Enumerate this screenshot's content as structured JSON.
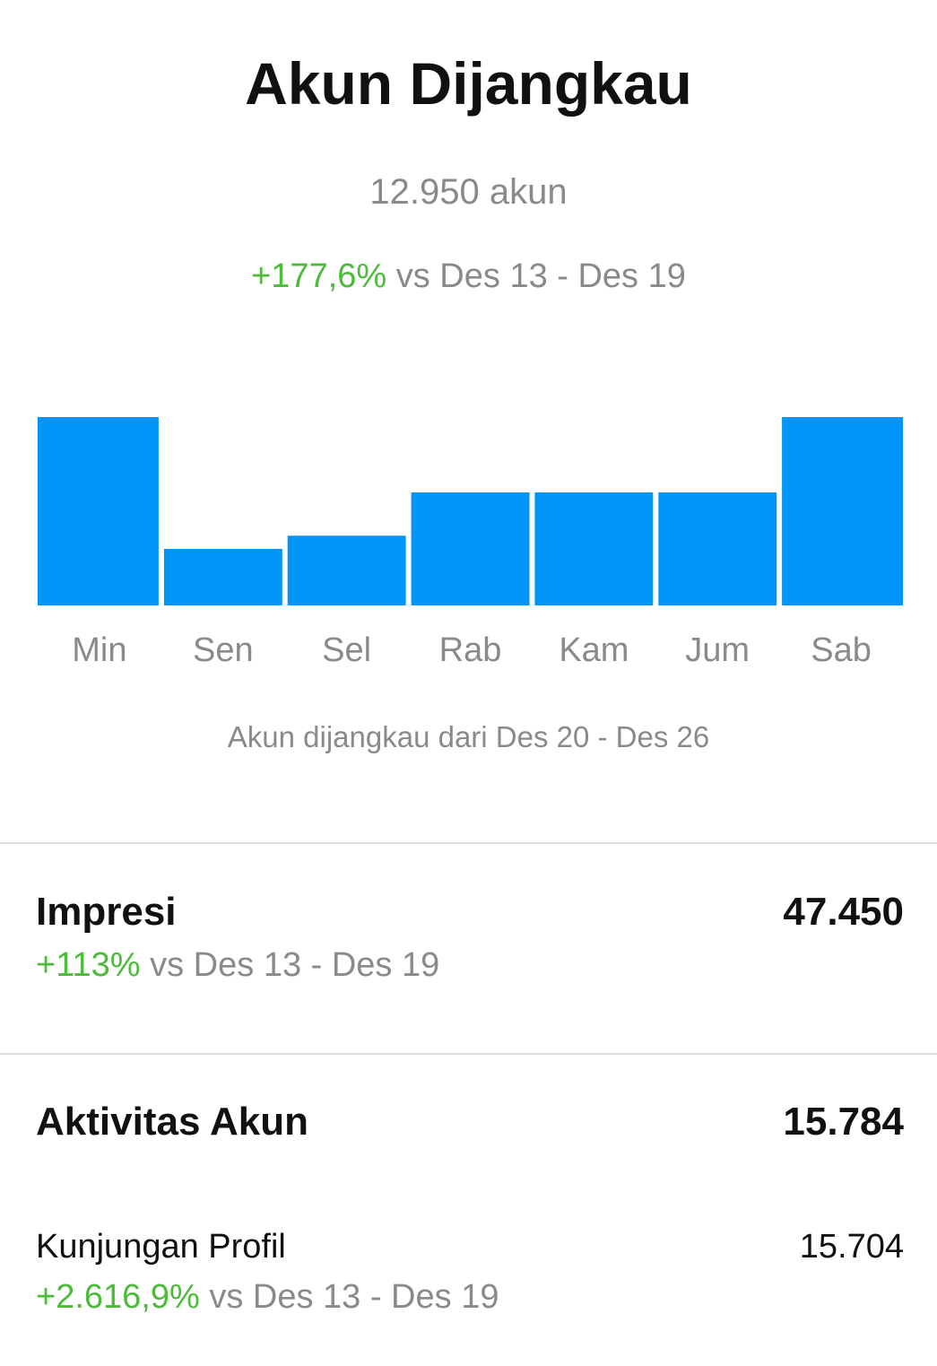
{
  "title": "Akun Dijangkau",
  "reach_summary": {
    "count_text": "12.950 akun",
    "change": "+177,6%",
    "comparison": "vs Des 13 - Des 19"
  },
  "chart_data": {
    "type": "bar",
    "categories": [
      "Min",
      "Sen",
      "Sel",
      "Rab",
      "Kam",
      "Jum",
      "Sab"
    ],
    "values": [
      100,
      30,
      37,
      60,
      60,
      60,
      100
    ],
    "bar_color": "#0095f6",
    "caption": "Akun dijangkau dari Des 20 - Des 26"
  },
  "metrics": {
    "impresi": {
      "label": "Impresi",
      "value": "47.450",
      "change": "+113%",
      "comparison": "vs Des 13 - Des 19"
    },
    "aktivitas": {
      "label": "Aktivitas Akun",
      "value": "15.784"
    },
    "kunjungan": {
      "label": "Kunjungan Profil",
      "value": "15.704",
      "change": "+2.616,9%",
      "comparison": "vs Des 13 - Des 19"
    }
  },
  "colors": {
    "positive": "#4cbb3a",
    "muted": "#8a8a8a",
    "accent": "#0095f6"
  }
}
